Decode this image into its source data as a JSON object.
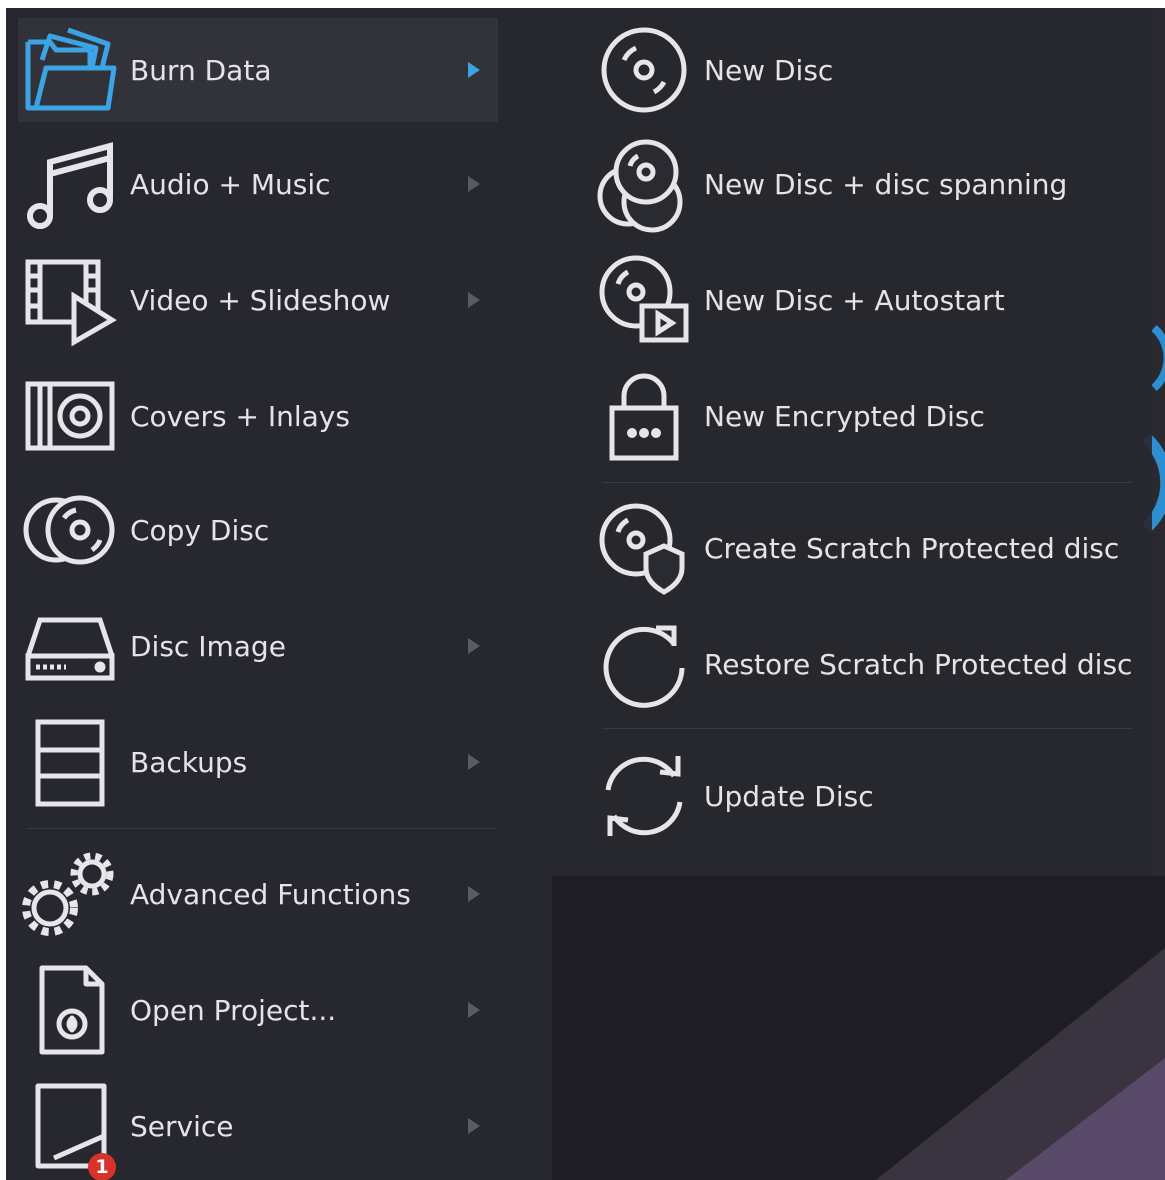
{
  "menu": {
    "items": [
      {
        "label": "Burn Data",
        "icon": "folder-icon",
        "active": true
      },
      {
        "label": "Audio + Music",
        "icon": "music-note-icon"
      },
      {
        "label": "Video + Slideshow",
        "icon": "video-icon"
      },
      {
        "label": "Covers + Inlays",
        "icon": "cover-icon"
      },
      {
        "label": "Copy Disc",
        "icon": "copy-disc-icon"
      },
      {
        "label": "Disc Image",
        "icon": "drive-icon"
      },
      {
        "label": "Backups",
        "icon": "backup-icon"
      },
      {
        "label": "Advanced Functions",
        "icon": "gears-icon"
      },
      {
        "label": "Open Project...",
        "icon": "project-file-icon"
      },
      {
        "label": "Service",
        "icon": "service-icon",
        "badge": "1"
      }
    ]
  },
  "submenu": {
    "items": [
      {
        "label": "New Disc",
        "icon": "disc-icon"
      },
      {
        "label": "New Disc + disc spanning",
        "icon": "disc-spanning-icon"
      },
      {
        "label": "New Disc + Autostart",
        "icon": "disc-autostart-icon"
      },
      {
        "label": "New Encrypted Disc",
        "icon": "lock-icon"
      },
      {
        "label": "Create Scratch Protected disc",
        "icon": "disc-shield-icon"
      },
      {
        "label": "Restore Scratch Protected disc",
        "icon": "restore-icon"
      },
      {
        "label": "Update Disc",
        "icon": "refresh-icon"
      }
    ]
  },
  "colors": {
    "accent": "#3ba4e4",
    "text": "#e3e3e8",
    "icon": "#e6e6ea",
    "badge": "#d8322b"
  }
}
